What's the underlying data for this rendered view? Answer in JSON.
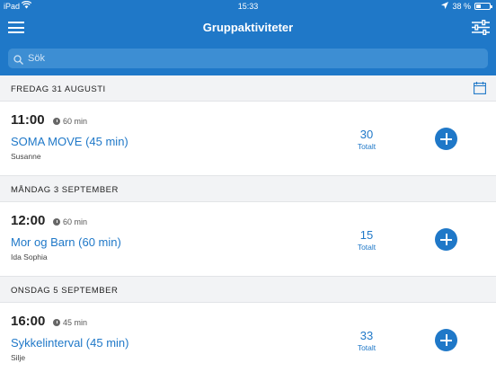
{
  "status_bar": {
    "carrier": "iPad",
    "time": "15:33",
    "battery": "38 %",
    "battery_level": 0.38
  },
  "nav": {
    "title": "Gruppaktiviteter"
  },
  "search": {
    "placeholder": "Sök",
    "value": ""
  },
  "sections": [
    {
      "date": "FREDAG 31 AUGUSTI",
      "activity": {
        "time": "11:00",
        "duration": "60 min",
        "name": "SOMA MOVE (45 min)",
        "instructor": "Susanne",
        "count": "30",
        "count_label": "Totalt"
      }
    },
    {
      "date": "MÅNDAG 3 SEPTEMBER",
      "activity": {
        "time": "12:00",
        "duration": "60 min",
        "name": "Mor og Barn (60 min)",
        "instructor": "Ida Sophia",
        "count": "15",
        "count_label": "Totalt"
      }
    },
    {
      "date": "ONSDAG 5 SEPTEMBER",
      "activity": {
        "time": "16:00",
        "duration": "45 min",
        "name": "Sykkelinterval (45 min)",
        "instructor": "Silje",
        "count": "33",
        "count_label": "Totalt"
      }
    }
  ],
  "colors": {
    "brand": "#1f78c8",
    "background": "#f2f3f5"
  }
}
